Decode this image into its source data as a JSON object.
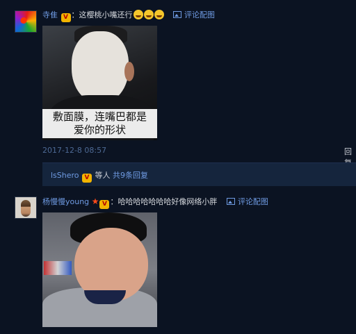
{
  "comment1": {
    "username": "寺隹",
    "separator": "：",
    "text": "这樱桃小嘴还行",
    "emoji_count": 3,
    "reply_image_label": "评论配图",
    "photo_caption_line1": "敷面膜，连嘴巴都是",
    "photo_caption_line2": "爱你的形状",
    "timestamp": "2017-12-8 08:57",
    "reply_action": "回复"
  },
  "replies": {
    "user": "lsShero",
    "middle": "等人",
    "count_link": "共9条回复"
  },
  "comment2": {
    "username": "杨慢慢young",
    "separator": "：",
    "text": "哈哈哈哈哈哈哈好像网络小胖",
    "reply_image_label": "评论配图"
  },
  "icons": {
    "badge": "vip-badge-icon",
    "star": "star-icon",
    "image": "image-icon",
    "emoji": "laughing-crying-emoji-icon"
  },
  "colors": {
    "background": "#0b1322",
    "link": "#6f9be3",
    "timestamp": "#4e6a95",
    "replies_box": "#15253d"
  }
}
